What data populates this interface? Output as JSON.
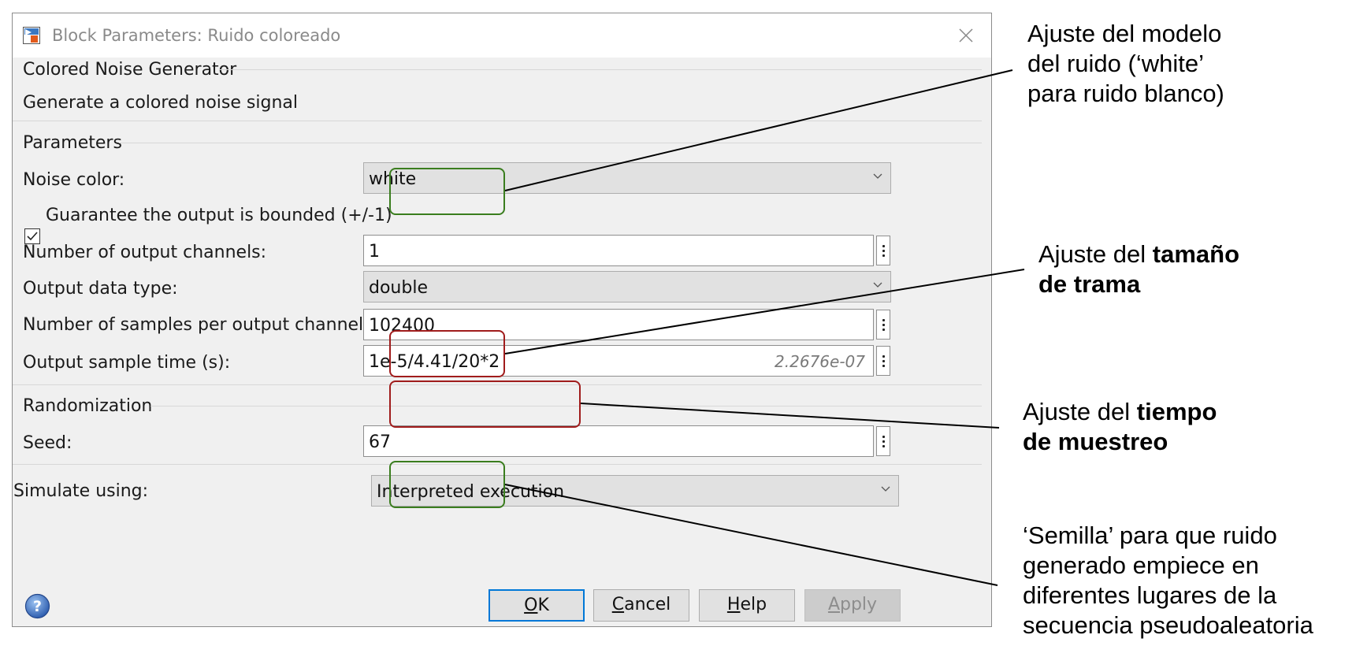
{
  "window": {
    "title": "Block Parameters: Ruido coloreado",
    "icon": "simulink-block-icon",
    "close_icon": "close-icon"
  },
  "header": {
    "group_title": "Colored Noise Generator",
    "description": "Generate a colored noise signal"
  },
  "parameters": {
    "group_title": "Parameters",
    "noise_color": {
      "label": "Noise color:",
      "value": "white"
    },
    "bounded": {
      "label": "Guarantee the output is bounded (+/-1)",
      "checked": true
    },
    "channels": {
      "label": "Number of output channels:",
      "value": "1"
    },
    "data_type": {
      "label": "Output data type:",
      "value": "double"
    },
    "samples": {
      "label": "Number of samples per output channel:",
      "value": "102400"
    },
    "sample_time": {
      "label": "Output sample time (s):",
      "value": "1e-5/4.41/20*2",
      "evaluated": "2.2676e-07"
    }
  },
  "randomization": {
    "group_title": "Randomization",
    "seed": {
      "label": "Seed:",
      "value": "67"
    }
  },
  "simulate": {
    "label": "Simulate using:",
    "value": "Interpreted execution"
  },
  "buttons": {
    "ok": {
      "mnemonic": "O",
      "rest": "K"
    },
    "cancel": {
      "mnemonic": "C",
      "rest": "ancel"
    },
    "help": {
      "mnemonic": "H",
      "rest": "elp"
    },
    "apply": {
      "mnemonic": "A",
      "rest": "pply"
    }
  },
  "annotations": {
    "noise_model": {
      "lines": [
        "Ajuste del modelo",
        "del ruido (‘white’",
        "para ruido blanco)"
      ]
    },
    "frame_size": {
      "normal": "Ajuste del ",
      "bold1": "tamaño",
      "bold2": "de trama"
    },
    "sample_time": {
      "normal": "Ajuste del ",
      "bold1": "tiempo",
      "bold2": "de muestreo"
    },
    "seed": {
      "lines": [
        "‘Semilla’ para que ruido",
        "generado empiece en",
        "diferentes lugares de la",
        "secuencia pseudoaleatoria"
      ]
    }
  },
  "colors": {
    "highlight_green": "#3a7d1e",
    "highlight_red": "#a01c1c",
    "default_button_border": "#0078d7"
  }
}
